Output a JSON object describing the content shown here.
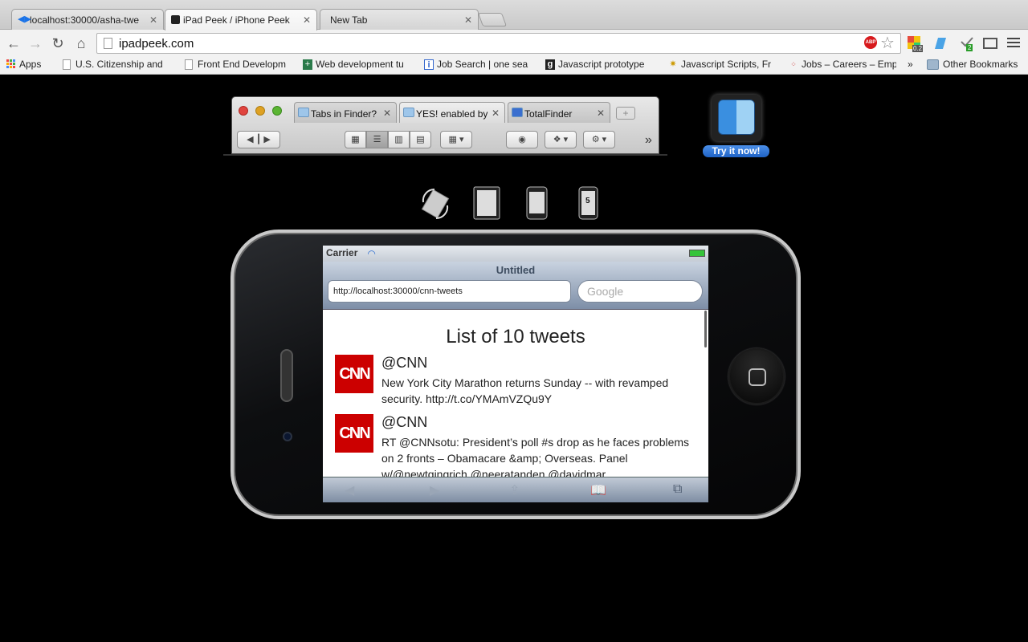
{
  "browser": {
    "tabs": [
      {
        "title": "localhost:30000/asha-twe",
        "active": false
      },
      {
        "title": "iPad Peek / iPhone Peek",
        "active": true
      },
      {
        "title": "New Tab",
        "active": false
      }
    ],
    "address": "ipadpeek.com",
    "extensions": {
      "abp": "ABP",
      "badge_one": "0.2",
      "badge_two": "2"
    },
    "bookmarks": [
      {
        "label": "Apps",
        "icon": "apps-grid-icon"
      },
      {
        "label": "U.S. Citizenship and",
        "icon": "page-icon"
      },
      {
        "label": "Front End Developm",
        "icon": "page-icon"
      },
      {
        "label": "Web development tu",
        "icon": "plus-icon"
      },
      {
        "label": "Job Search | one sea",
        "icon": "info-icon"
      },
      {
        "label": "Javascript prototype",
        "icon": "g-icon"
      },
      {
        "label": "Javascript Scripts, Fr",
        "icon": "star-icon"
      },
      {
        "label": "Jobs – Careers – Emp",
        "icon": "dots-icon"
      },
      {
        "label": "»",
        "icon": ""
      },
      {
        "label": "Other Bookmarks",
        "icon": "folder-icon"
      }
    ]
  },
  "finder_preview": {
    "tabs": [
      "Tabs in Finder?",
      "YES! enabled by",
      "TotalFinder"
    ],
    "app_button": "Try it now!"
  },
  "device_selector": [
    "rotate",
    "ipad",
    "iphone",
    "iphone-5"
  ],
  "device_labels": {
    "iphone5": "5"
  },
  "phone": {
    "carrier": "Carrier",
    "page_title": "Untitled",
    "url": "http://localhost:30000/cnn-tweets",
    "search_placeholder": "Google",
    "list_title": "List of 10 tweets",
    "tweets": [
      {
        "logo": "CNN",
        "handle": "@CNN",
        "text": "New York City Marathon returns Sunday -- with revamped security. http://t.co/YMAmVZQu9Y"
      },
      {
        "logo": "CNN",
        "handle": "@CNN",
        "text": "RT @CNNsotu: President’s poll #s drop as he faces problems on 2 fronts – Obamacare &amp; Overseas. Panel w/@newtgingrich @neeratanden @davidmar…"
      }
    ]
  },
  "colors": {
    "accent": "#2f6fd0",
    "cnn_red": "#cc0000",
    "background": "#000000"
  }
}
